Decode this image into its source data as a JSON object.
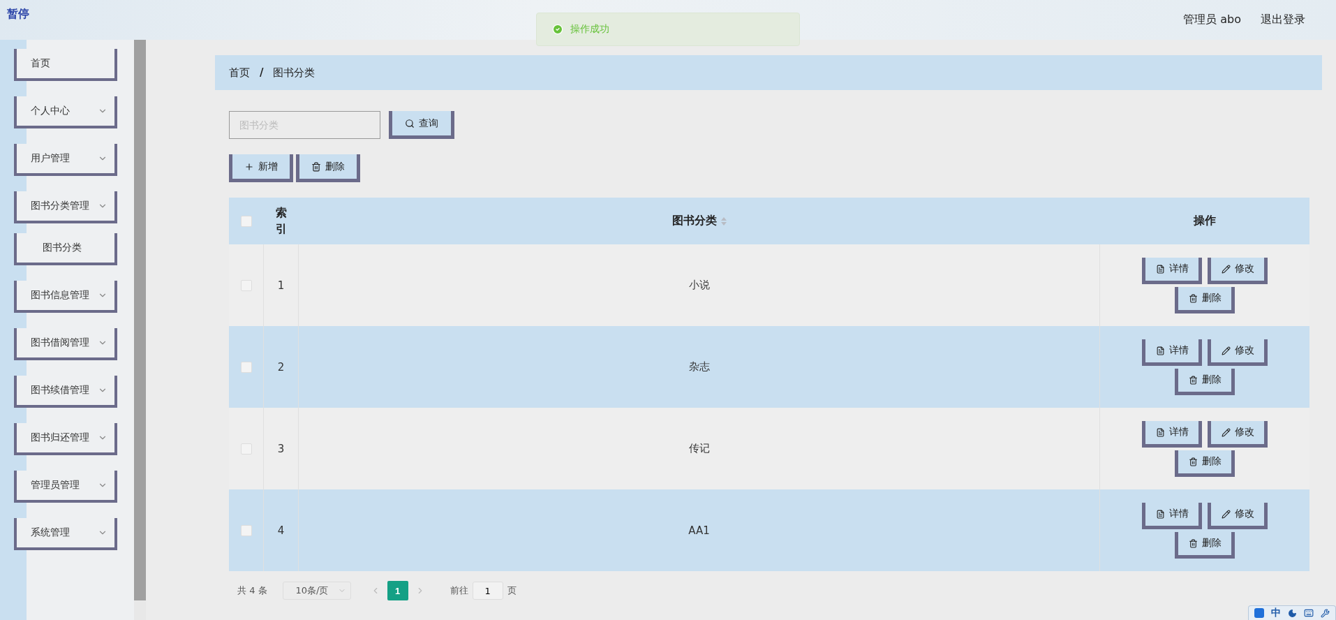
{
  "header": {
    "pause_label": "暂停",
    "user": "管理员 abo",
    "logout": "退出登录"
  },
  "toast": {
    "message": "操作成功"
  },
  "sidebar": {
    "items": [
      {
        "label": "首页",
        "kind": "link"
      },
      {
        "label": "个人中心",
        "kind": "menu"
      },
      {
        "label": "用户管理",
        "kind": "menu"
      },
      {
        "label": "图书分类管理",
        "kind": "menu",
        "children": [
          {
            "label": "图书分类"
          }
        ]
      },
      {
        "label": "图书信息管理",
        "kind": "menu"
      },
      {
        "label": "图书借阅管理",
        "kind": "menu"
      },
      {
        "label": "图书续借管理",
        "kind": "menu"
      },
      {
        "label": "图书归还管理",
        "kind": "menu"
      },
      {
        "label": "管理员管理",
        "kind": "menu"
      },
      {
        "label": "系统管理",
        "kind": "menu"
      }
    ]
  },
  "breadcrumb": {
    "items": [
      "首页",
      "图书分类"
    ],
    "separator": "/"
  },
  "search": {
    "placeholder": "图书分类",
    "button": "查询"
  },
  "actions": [
    {
      "label": "新增",
      "kind": "add"
    },
    {
      "label": "删除",
      "kind": "delete"
    }
  ],
  "table": {
    "select_all_checked": false,
    "columns": [
      {
        "label": "索引",
        "sortable": false
      },
      {
        "label": "图书分类",
        "sortable": true
      },
      {
        "label": "操作",
        "sortable": false
      }
    ],
    "rows": [
      {
        "index": "1",
        "name": "小说",
        "checked": false,
        "actions": [
          "详情",
          "修改",
          "删除"
        ]
      },
      {
        "index": "2",
        "name": "杂志",
        "checked": false,
        "actions": [
          "详情",
          "修改",
          "删除"
        ]
      },
      {
        "index": "3",
        "name": "传记",
        "checked": false,
        "actions": [
          "详情",
          "修改",
          "删除"
        ]
      },
      {
        "index": "4",
        "name": "AA1",
        "checked": false,
        "actions": [
          "详情",
          "修改",
          "删除"
        ]
      }
    ]
  },
  "pagination": {
    "total": "共 4 条",
    "page_size": "10条/页",
    "pages": [
      {
        "label": "1",
        "selected": true
      }
    ],
    "goto_label": "前往",
    "goto_value": "1",
    "page_suffix": "页"
  },
  "ime_bar": {
    "mode": "中"
  }
}
